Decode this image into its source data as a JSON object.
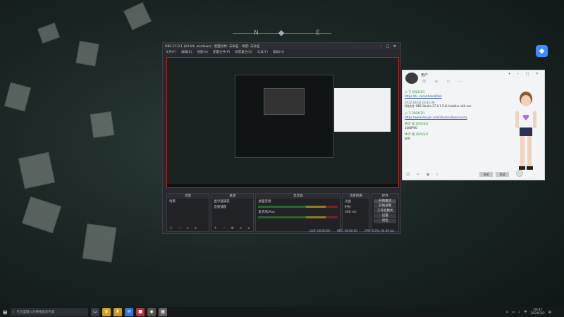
{
  "compass": {
    "n": "N",
    "e": "E"
  },
  "obs": {
    "title": "OBS 27.0.1 (64-bit, windows) - 配置文件: 未命名 - 场景: 未命名",
    "menu": [
      "文件(F)",
      "编辑(E)",
      "视图(V)",
      "配置文件(P)",
      "场景集合(S)",
      "工具(T)",
      "帮助(H)"
    ],
    "docks": {
      "scenes": {
        "title": "场景",
        "items": [
          "场景"
        ]
      },
      "sources": {
        "title": "来源",
        "items": [
          "显示器捕获",
          "音频捕获"
        ]
      },
      "mixer": {
        "title": "混音器",
        "channels": [
          "桌面音频",
          "麦克风/Aux"
        ]
      },
      "transitions": {
        "title": "场景转换",
        "type": "淡出",
        "duration_label": "时长",
        "duration": "300 ms"
      },
      "controls": {
        "title": "控件",
        "buttons": [
          "开始推流",
          "开始录制",
          "工作室模式",
          "设置",
          "退出"
        ]
      }
    },
    "status": [
      "LIVE: 00:00:00",
      "REC: 00:00:00",
      "CPU: 0.5%, 60.00 fps"
    ]
  },
  "chat": {
    "contact": "用户",
    "messages": [
      {
        "sender": "小 子 2024/3/1",
        "text": "https://b...com/shared/link",
        "kind": "link"
      },
      {
        "sender": "2022-03-02 23:42:36",
        "text": "QQ文件 OBS Studio 27.0.1 Full Installer x64.exe",
        "kind": "file"
      },
      {
        "sender": "小 子 2024/3/1",
        "text": "https://www.douyin.com/share/video/xxxxxx",
        "kind": "link"
      },
      {
        "sender": "MOY 我 2024/3/2",
        "text": "1080P60",
        "kind": "text"
      },
      {
        "sender": "MOY 我 2024/3/2",
        "text": "好的",
        "kind": "text"
      }
    ],
    "buttons": {
      "close": "关闭",
      "send": "发送"
    }
  },
  "taskbar": {
    "search_placeholder": "在这里输入你要搜索的内容",
    "time": "19:47",
    "date": "2024/3/2",
    "lang": "中"
  },
  "colors": {
    "obs_red_border": "#c21b1b",
    "chat_green": "#2a8a2a",
    "accent": "#3d8bff"
  }
}
